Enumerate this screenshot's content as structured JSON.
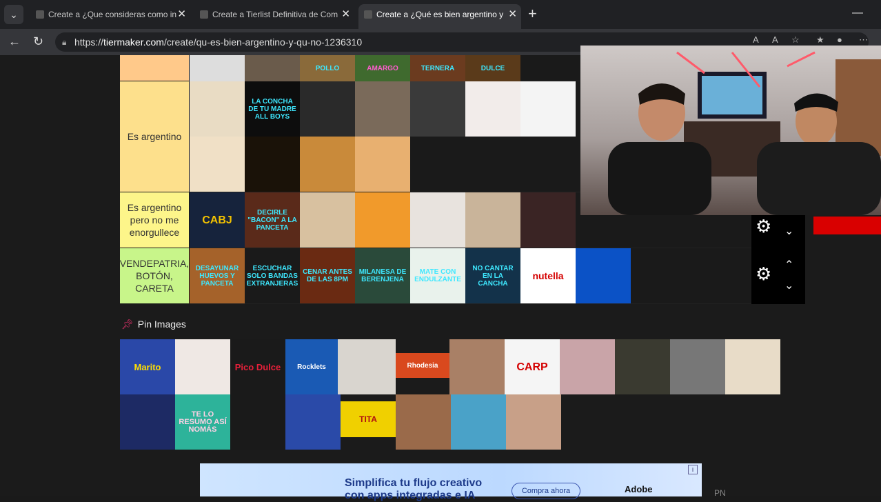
{
  "browser": {
    "tabs": [
      {
        "label": "Create a ¿Que consideras como in"
      },
      {
        "label": "Create a Tierlist Definitiva de Com"
      },
      {
        "label": "Create a ¿Qué es bien argentino y"
      }
    ],
    "url_prefix": "https://",
    "url_host": "tiermaker.com",
    "url_path": "/create/qu-es-bien-argentino-y-qu-no-1236310"
  },
  "tiers": [
    {
      "label": "",
      "color": "#ffc98a"
    },
    {
      "label": "Es argentino",
      "color": "#fde08c"
    },
    {
      "label": "Es argentino pero no me enorgullece",
      "color": "#fdf58a"
    },
    {
      "label": "VENDEPATRIA, BOTÓN, CARETA",
      "color": "#c8f58a"
    }
  ],
  "tiles": {
    "row0": [
      "",
      "",
      "POLLO",
      "AMARGO",
      "TERNERA",
      "DULCE"
    ],
    "row1a": [
      "",
      "LA CONCHA DE TU MADRE ALL BOYS",
      "",
      "",
      "",
      "",
      ""
    ],
    "row1b": [
      "",
      "",
      "",
      ""
    ],
    "row2": [
      "CABJ",
      "DECIRLE \"BACON\" A LA PANCETA",
      "",
      "",
      "",
      "",
      ""
    ],
    "row3": [
      "DESAYUNAR HUEVOS Y PANCETA",
      "ESCUCHAR SOLO BANDAS EXTRANJERAS",
      "CENAR ANTES DE LAS 8PM",
      "MILANESA DE BERENJENA",
      "MATE CON ENDULZANTE",
      "NO CANTAR EN LA CANCHA",
      "nutella",
      ""
    ]
  },
  "pin_section": {
    "title": "Pin Images"
  },
  "pin_tiles": {
    "row1": [
      "Marito",
      "",
      "Pico Dulce",
      "Rocklets",
      "",
      "Rhodesia",
      "",
      "CARP",
      "",
      "",
      "",
      ""
    ],
    "row2": [
      "",
      "TE LO RESUMO ASÍ NOMÁS",
      "",
      "",
      "TITA",
      "",
      "",
      ""
    ]
  },
  "ad": {
    "line1": "Simplifica tu flujo creativo",
    "line2": "con apps integradas e IA",
    "button": "Compra ahora",
    "brand": "Adobe"
  },
  "footer_text": "PN"
}
